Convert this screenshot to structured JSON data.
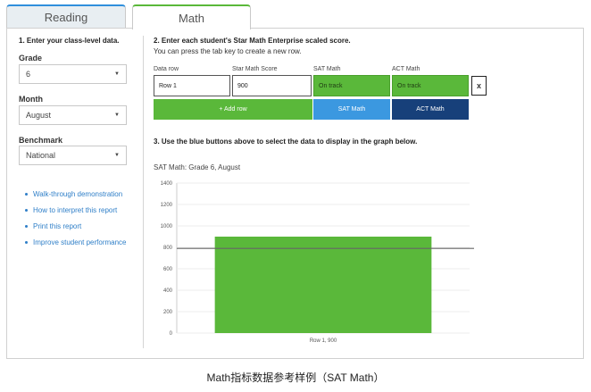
{
  "tabs": [
    {
      "label": "Reading"
    },
    {
      "label": "Math"
    }
  ],
  "left": {
    "step1": "1. Enter your class-level data.",
    "grade_label": "Grade",
    "grade_value": "6",
    "month_label": "Month",
    "month_value": "August",
    "benchmark_label": "Benchmark",
    "benchmark_value": "National",
    "links": [
      "Walk-through demonstration",
      "How to interpret this report",
      "Print this report",
      "Improve student performance"
    ]
  },
  "right": {
    "step2": "2. Enter each student's Star Math Enterprise scaled score.",
    "step2_sub": "You can press the tab key to create a new row.",
    "columns": [
      "Data row",
      "Star Math Score",
      "SAT Math",
      "ACT Math"
    ],
    "row": {
      "data_row": "Row 1",
      "score": "900",
      "sat": "On track",
      "act": "On track"
    },
    "remove_label": "x",
    "add_row_label": "+ Add row",
    "sat_button_label": "SAT Math",
    "act_button_label": "ACT Math",
    "step3": "3. Use the blue buttons above to select the data to display in the graph below."
  },
  "colors": {
    "green": "#5ab83a",
    "blue": "#3b98e0",
    "navy": "#17407a",
    "benchmark_line": "#666666"
  },
  "chart_data": {
    "type": "bar",
    "title": "SAT Math: Grade 6, August",
    "categories": [
      "Row 1, 900"
    ],
    "values": [
      900
    ],
    "benchmark": 790,
    "ylim": [
      0,
      1400
    ],
    "yticks": [
      "0",
      "200",
      "400",
      "600",
      "800",
      "1000",
      "1200",
      "1400"
    ],
    "grid": true
  },
  "caption": "Math指标数据参考样例（SAT Math）"
}
